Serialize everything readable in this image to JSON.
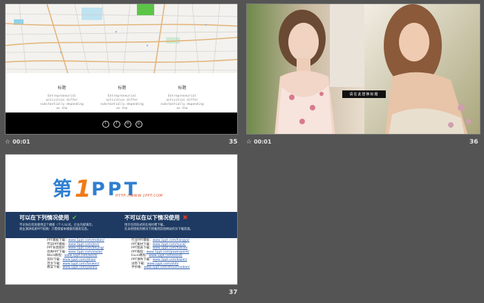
{
  "slides": [
    {
      "number": "35",
      "time": "00:01",
      "features": [
        {
          "title": "标题",
          "desc": "Entrepreneurial activities differ substantially depending on the"
        },
        {
          "title": "标题",
          "desc": "Entrepreneurial activities differ substantially depending on the"
        },
        {
          "title": "标题",
          "desc": "Entrepreneurial activities differ substantially depending on the"
        }
      ],
      "social_icons": [
        "twitter-icon",
        "facebook-icon",
        "linkedin-icon",
        "instagram-icon"
      ]
    },
    {
      "number": "36",
      "time": "00:01",
      "caption": "请在此替换标题"
    },
    {
      "number": "37",
      "logo_text": "第1PPT",
      "logo_url": "HTTP://WWW.1PPT.COM",
      "can_use": {
        "heading": "可以在下列情况使用",
        "lines": [
          "不论你在何处使用这个模板（个人/公司，企业内部演示。",
          "商业演讲或者PPT投稿）只需保留本模板的版权信息。"
        ]
      },
      "cannot_use": {
        "heading": "不可以在以下情况使用",
        "lines": [
          "用于任何形式的在线付费下载。",
          "在未经授权的情况下转载到其他网站作为下载资源。"
        ]
      },
      "links_left": [
        {
          "label": "PPT模板下载：",
          "url": "www.1ppt.com/moban/"
        },
        {
          "label": "节日PPT模板：",
          "url": "www.1ppt.com/jieri/"
        },
        {
          "label": "PPT背景图片：",
          "url": "www.1ppt.com/beijing/"
        },
        {
          "label": "优秀PPT下载：",
          "url": "www.1ppt.com/xiazai/"
        },
        {
          "label": "Word教程：",
          "url": "www.1ppt.com/word/"
        },
        {
          "label": "资料下载：",
          "url": "www.1ppt.com/ziliao/"
        },
        {
          "label": "范文下载：",
          "url": "www.1ppt.com/fanwen/"
        },
        {
          "label": "教案下载：",
          "url": "www.1ppt.com/jiaoan/"
        }
      ],
      "links_right": [
        {
          "label": "行业PPT模板：",
          "url": "www.1ppt.com/hangye/"
        },
        {
          "label": "PPT素材下载：",
          "url": "www.1ppt.com/sucai/"
        },
        {
          "label": "PPT图表下载：",
          "url": "www.1ppt.com/tubiao/"
        },
        {
          "label": "PPT教程：",
          "url": "www.1ppt.com/powerpoint/"
        },
        {
          "label": "Excel教程：",
          "url": "www.1ppt.com/excel/"
        },
        {
          "label": "PPT课件下载：",
          "url": "www.1ppt.com/kejian/"
        },
        {
          "label": "试卷下载：",
          "url": "www.1ppt.com/shiti/"
        },
        {
          "label": "手抄报：",
          "url": "www.1ppt.com/shouchaobao/"
        }
      ]
    }
  ]
}
